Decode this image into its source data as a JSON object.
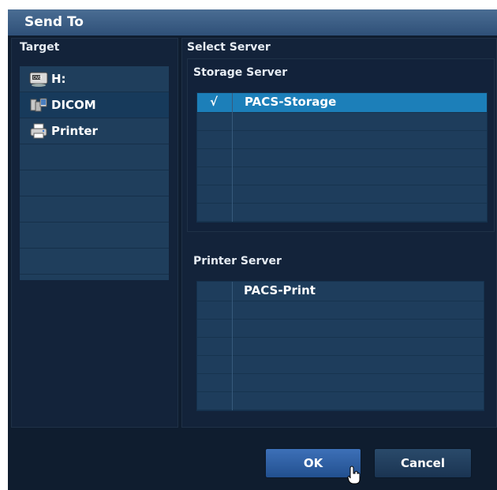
{
  "dialog": {
    "title": "Send To"
  },
  "target": {
    "label": "Target",
    "items": [
      {
        "label": "H:",
        "icon": "disk-drive-icon"
      },
      {
        "label": "DICOM",
        "icon": "dicom-network-icon"
      },
      {
        "label": "Printer",
        "icon": "printer-icon"
      }
    ],
    "selected_index": 1
  },
  "server": {
    "label": "Select Server",
    "storage": {
      "label": "Storage Server",
      "rows": [
        {
          "check": "√",
          "name": "PACS-Storage"
        }
      ]
    },
    "printer": {
      "label": "Printer Server",
      "rows": [
        {
          "check": "",
          "name": "PACS-Print"
        }
      ]
    }
  },
  "buttons": {
    "ok": "OK",
    "cancel": "Cancel"
  },
  "colors": {
    "accent": "#1c7fb9",
    "title_bar": "#3b5f87",
    "ok_button": "#2f62a8"
  }
}
